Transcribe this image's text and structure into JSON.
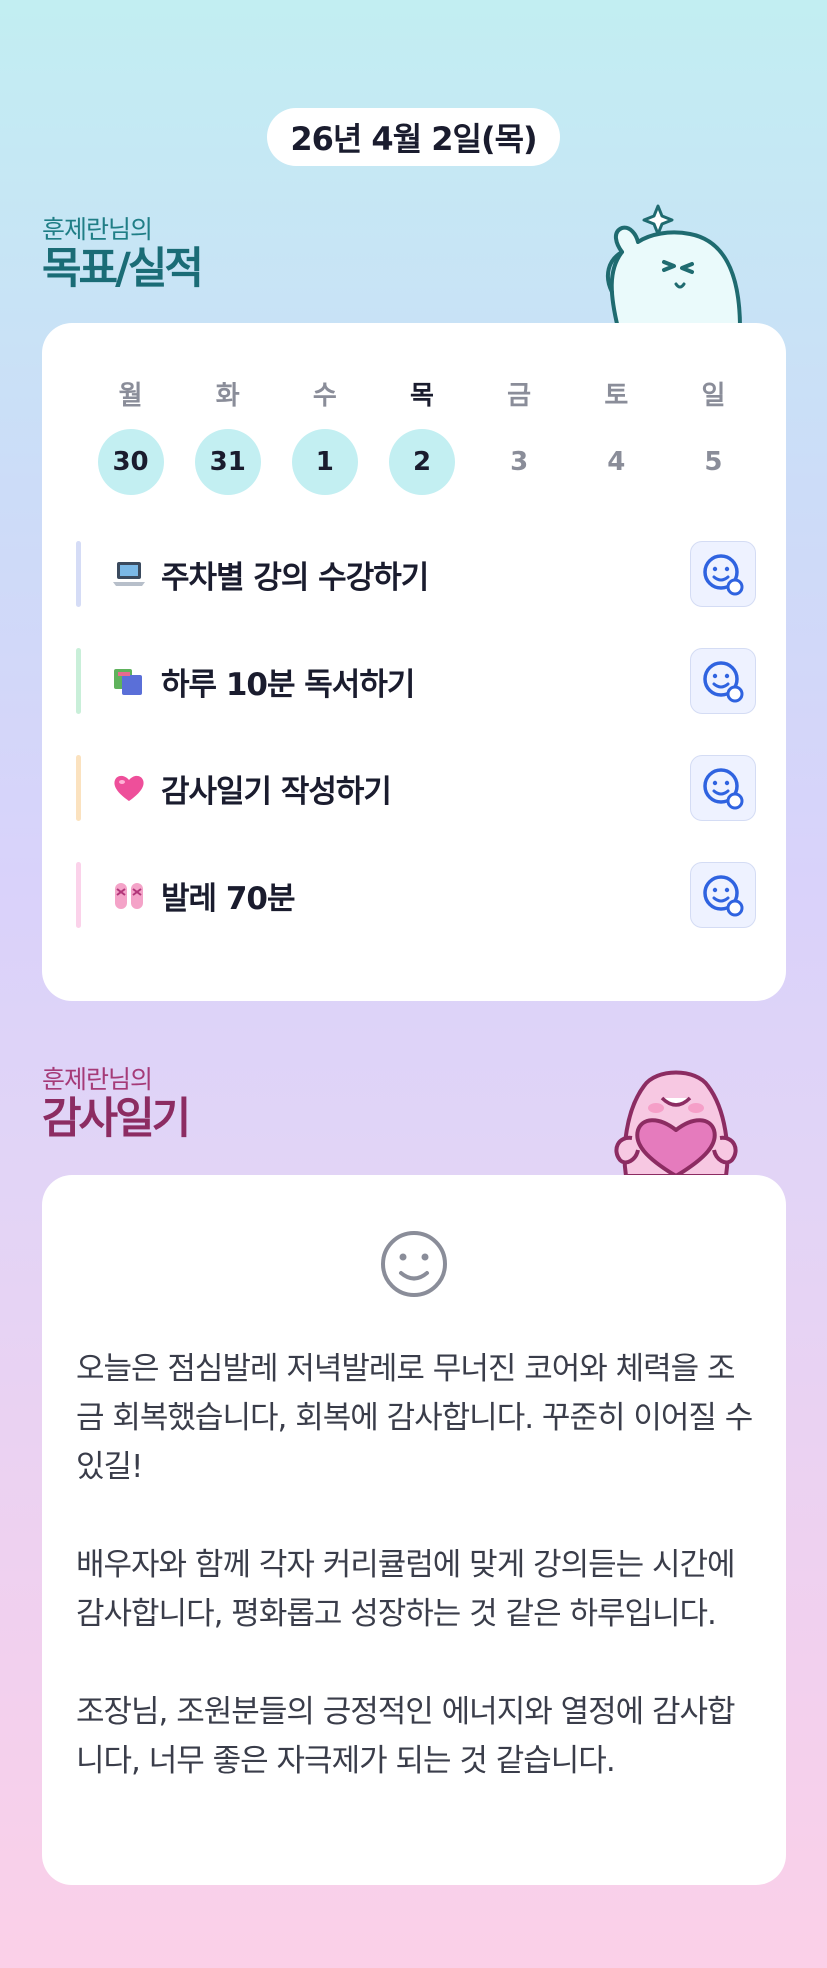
{
  "date_label": "26년 4월 2일(목)",
  "goals_section": {
    "subtitle": "훈제란님의",
    "title": "목표/실적"
  },
  "week": [
    {
      "day": "월",
      "date": "30",
      "done": true,
      "today": false
    },
    {
      "day": "화",
      "date": "31",
      "done": true,
      "today": false
    },
    {
      "day": "수",
      "date": "1",
      "done": true,
      "today": false
    },
    {
      "day": "목",
      "date": "2",
      "done": true,
      "today": true
    },
    {
      "day": "금",
      "date": "3",
      "done": false,
      "today": false
    },
    {
      "day": "토",
      "date": "4",
      "done": false,
      "today": false
    },
    {
      "day": "일",
      "date": "5",
      "done": false,
      "today": false
    }
  ],
  "goals": [
    {
      "icon": "laptop-icon",
      "label": "주차별 강의 수강하기",
      "bar_color": "#d5dcf6"
    },
    {
      "icon": "books-icon",
      "label": "하루 10분 독서하기",
      "bar_color": "#c9efd9"
    },
    {
      "icon": "heart-icon",
      "label": "감사일기 작성하기",
      "bar_color": "#fbe2bf"
    },
    {
      "icon": "ballet-shoes-icon",
      "label": "발레 70분",
      "bar_color": "#fbd2ea"
    }
  ],
  "diary_section": {
    "subtitle": "훈제란님의",
    "title": "감사일기"
  },
  "diary": {
    "mood_icon": "smile-icon",
    "paragraphs": [
      "오늘은 점심발레 저녁발레로 무너진 코어와 체력을 조금 회복했습니다, 회복에 감사합니다. 꾸준히 이어질 수 있길!",
      "배우자와 함께 각자 커리큘럼에 맞게 강의듣는 시간에 감사합니다, 평화롭고 성장하는 것 같은 하루입니다.",
      "조장님, 조원분들의 긍정적인 에너지와 열정에 감사합니다, 너무 좋은 자극제가 되는 것 같습니다."
    ]
  },
  "colors": {
    "done_circle": "#c3eff2",
    "check_icon": "#2f63e0",
    "goal_title": "#1a6c76",
    "diary_title": "#8c2c62"
  }
}
